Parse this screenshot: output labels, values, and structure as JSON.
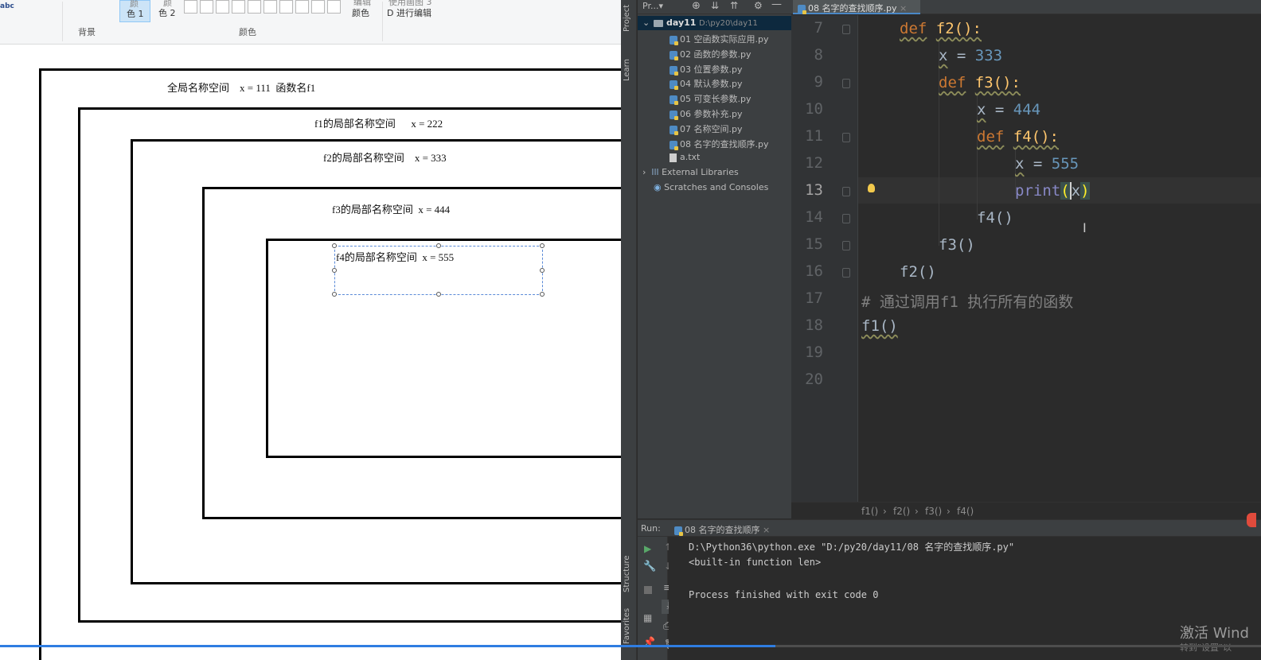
{
  "paint": {
    "ribbon": {
      "color1_label": "色 1",
      "color2_label": "色 2",
      "color1_top": "颜",
      "color2_top": "颜",
      "edit_colors_label": "颜色",
      "edit_paint3d_label": "D 进行编辑",
      "edit_paint3d_top": "使用画图 3",
      "edit_colors_top": "编辑",
      "group_background": "背景",
      "group_colors": "颜色",
      "left_glyphs": "abc"
    },
    "namespaces": {
      "global": "全局名称空间    x = 111  函数名f1",
      "f1": "f1的局部名称空间      x = 222",
      "f2": "f2的局部名称空间    x = 333",
      "f3": "f3的局部名称空间  x = 444",
      "f4": "f4的局部名称空间  x = 555"
    }
  },
  "ide": {
    "strip": {
      "project": "Project",
      "learn": "Learn",
      "structure": "Structure",
      "favorites": "Favorites"
    },
    "project_toolbar": {
      "title": "Pr...",
      "dropdown": "▾"
    },
    "tree": {
      "root": "day11",
      "root_path": "D:\\py20\\day11",
      "files": [
        "01 空函数实际应用.py",
        "02 函数的参数.py",
        "03 位置参数.py",
        "04 默认参数.py",
        "05 可变长参数.py",
        "06 参数补充.py",
        "07 名称空间.py",
        "08 名字的查找顺序.py"
      ],
      "txt_file": "a.txt",
      "external": "External Libraries",
      "scratches": "Scratches and Consoles"
    },
    "tab_label": "08 名字的查找顺序.py",
    "tab_close": "×",
    "line_numbers": [
      "7",
      "8",
      "9",
      "10",
      "11",
      "12",
      "13",
      "14",
      "15",
      "16",
      "17",
      "18",
      "19",
      "20"
    ],
    "code": {
      "l7_kw": "def",
      "l7_name": "f2():",
      "l8_var": "x",
      "l8_op": " = ",
      "l8_num": "333",
      "l9_kw": "def",
      "l9_name": "f3():",
      "l10_var": "x",
      "l10_op": " = ",
      "l10_num": "444",
      "l11_kw": "def",
      "l11_name": "f4():",
      "l12_var": "x",
      "l12_op": " = ",
      "l12_num": "555",
      "l13_call": "print",
      "l13_open": "(",
      "l13_arg": "x",
      "l13_close": ")",
      "l14": "f4()",
      "l15": "f3()",
      "l16": "f2()",
      "l17": "# 通过调用f1 执行所有的函数",
      "l18": "f1()"
    },
    "breadcrumbs": [
      "f1()",
      "f2()",
      "f3()",
      "f4()"
    ],
    "crumb_sep": "›",
    "run": {
      "label": "Run:",
      "tab": "08 名字的查找顺序",
      "tab_close": "×",
      "console": [
        "D:\\Python36\\python.exe \"D:/py20/day11/08 名字的查找顺序.py\"",
        "<built-in function len>",
        "",
        "Process finished with exit code 0"
      ]
    },
    "watermark": "激活 Wind",
    "watermark_sub": "转到\"设置\"以"
  },
  "colors": {
    "keyword": "#cc7832",
    "function": "#ffc66d",
    "number": "#6897bb",
    "comment": "#808080",
    "selection_blue": "#4a88c7",
    "ide_bg": "#2b2b2b",
    "panel_bg": "#3c3f41"
  },
  "progress": {
    "fraction": 0.615
  }
}
